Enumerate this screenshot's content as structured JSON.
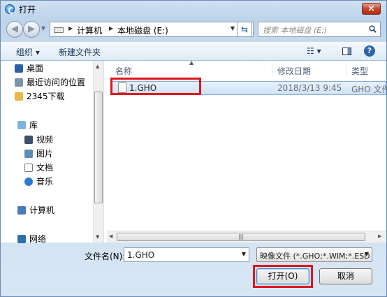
{
  "window": {
    "title": "打开",
    "close_label": "×"
  },
  "address_bar": {
    "crumbs": [
      "计算机",
      "本地磁盘 (E:)"
    ],
    "search_placeholder": "搜索 本地磁盘 (E:)"
  },
  "toolbar": {
    "organize": "组织 ▾",
    "new_folder": "新建文件夹",
    "view_label": "☷ ▾",
    "help": "?"
  },
  "sidebar": {
    "items": [
      {
        "label": "桌面",
        "icon": "desktop-icon"
      },
      {
        "label": "最近访问的位置",
        "icon": "recent-places-icon"
      },
      {
        "label": "2345下载",
        "icon": "folder-icon"
      },
      {
        "label": "库",
        "icon": "library-icon"
      },
      {
        "label": "视频",
        "icon": "video-icon"
      },
      {
        "label": "图片",
        "icon": "pictures-icon"
      },
      {
        "label": "文档",
        "icon": "documents-icon"
      },
      {
        "label": "音乐",
        "icon": "music-icon"
      },
      {
        "label": "计算机",
        "icon": "computer-icon"
      },
      {
        "label": "网络",
        "icon": "network-icon"
      }
    ]
  },
  "filelist": {
    "columns": [
      "名称",
      "修改日期",
      "类型"
    ],
    "rows": [
      {
        "name": "1.GHO",
        "modified": "2018/3/13 9:45",
        "type": "GHO 文件"
      }
    ]
  },
  "bottom": {
    "filename_label": "文件名(N):",
    "filename_value": "1.GHO",
    "filetype_value": "映像文件 (*.GHO;*.WIM;*.ESD",
    "open_button": "打开(O)",
    "cancel_button": "取消"
  },
  "colors": {
    "highlight_box": "#e0141e",
    "selection": "#cfe3fb",
    "link_text": "#1e395b"
  }
}
